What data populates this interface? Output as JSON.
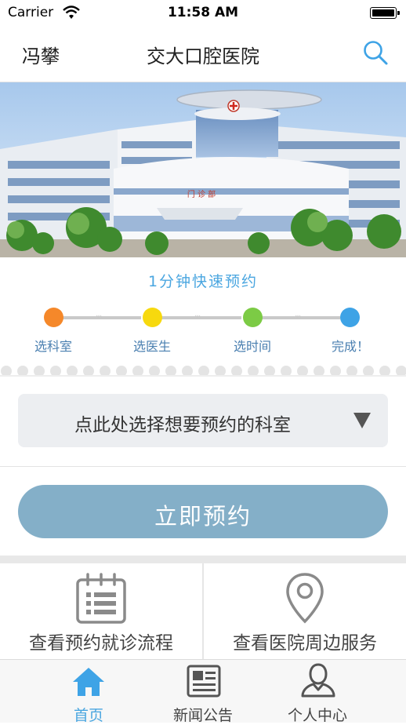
{
  "status_bar": {
    "carrier": "Carrier",
    "time": "11:58 AM"
  },
  "nav": {
    "city": "冯攀",
    "title": "交大口腔医院"
  },
  "banner": {
    "sign_text": "门 诊 部"
  },
  "booking": {
    "quick_title": "1分钟快速预约",
    "steps": [
      {
        "label": "选科室",
        "color": "#f5882a"
      },
      {
        "label": "选医生",
        "color": "#f7d90e"
      },
      {
        "label": "选时间",
        "color": "#7ccb45"
      },
      {
        "label": "完成！",
        "color": "#3ea3e6"
      }
    ],
    "department_placeholder": "点此处选择想要预约的科室",
    "book_button": "立即预约"
  },
  "shortcuts": [
    {
      "label": "查看预约就诊流程",
      "icon": "calendar-list-icon"
    },
    {
      "label": "查看医院周边服务",
      "icon": "location-pin-icon"
    }
  ],
  "tab_bar": {
    "tabs": [
      {
        "label": "首页",
        "icon": "home-icon",
        "active": true
      },
      {
        "label": "新闻公告",
        "icon": "newspaper-icon",
        "active": false
      },
      {
        "label": "个人中心",
        "icon": "user-icon",
        "active": false
      }
    ]
  },
  "colors": {
    "accent": "#4aa6e0",
    "book_button": "#84afc8",
    "select_bg": "#eceef1"
  }
}
